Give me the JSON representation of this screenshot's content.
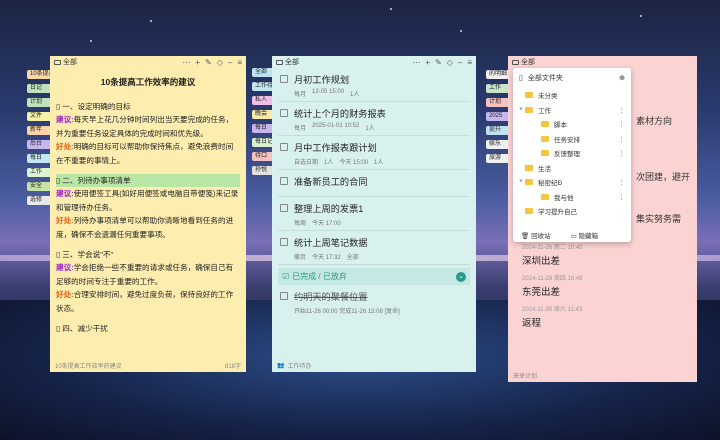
{
  "left_tags": [
    "10条提高",
    "日记",
    "计划",
    "文件",
    "新年",
    "后台",
    "每日",
    "工作",
    "安全",
    "选修"
  ],
  "mid_tags": [
    "全部",
    "工作待",
    "私人",
    "晚会",
    "每日",
    "每日记",
    "待口",
    "孙悦"
  ],
  "right_tags": [
    "的明细",
    "工作",
    "计划",
    "2025",
    "提升",
    "娱乐",
    "旅游"
  ],
  "note1": {
    "window_title": "全部",
    "title": "10条提高工作效率的建议",
    "s1_head": "一、设定明确的目标",
    "s1_kw": "建议:",
    "s1_text": "每天早上花几分钟时间列出当天要完成的任务，并为重要任务设定具体的完成时间和优先级。",
    "s1_kw2": "好处:",
    "s1_text2": "明确的目标可以帮助你保持焦点，避免浪费时间在不重要的事情上。",
    "s2_head": "二、列待办事项清单",
    "s2_kw": "建议:",
    "s2_text": "使用便签工具(如好用便签或电脑自带便笺)来记录和管理待办任务。",
    "s2_kw2": "好处:",
    "s2_text2": "列待办事项清单可以帮助你清晰地看到任务的进度，确保不会遗漏任何重要事项。",
    "s3_head": "三、学会说\"不\"",
    "s3_kw": "建议:",
    "s3_text": "学会拒绝一些不重要的请求或任务，确保自己有足够的时间专注于重要的工作。",
    "s3_kw2": "好处:",
    "s3_text2": "合理安排时间，避免过度负荷，保持良好的工作状态。",
    "s4_head": "四、减少干扰",
    "footer_name": "10条提高工作效率的建议",
    "footer_count": "818字"
  },
  "note2": {
    "window_title": "全部",
    "tasks": [
      {
        "title": "月初工作规划",
        "meta": [
          "每月",
          "12-05 15:00",
          "1人"
        ]
      },
      {
        "title": "统计上个月的财务报表",
        "meta": [
          "每月",
          "2025-01-01 10:52",
          "1人"
        ]
      },
      {
        "title": "月中工作报表跟计划",
        "meta": [
          "自选日期",
          "1人",
          "今天 15:00",
          "1人"
        ]
      },
      {
        "title": "准备新员工的合同",
        "meta": []
      },
      {
        "title": "整理上周的发票1",
        "meta": [
          "每周",
          "今天 17:00"
        ]
      },
      {
        "title": "统计上周笔记数据",
        "meta": [
          "撤页",
          "今天 17:32",
          "全部"
        ]
      }
    ],
    "done_header": "已完成 / 已放弃",
    "done_task": "约明天的聚餐位置",
    "done_meta": "开始11-26 00:00  完成11-26 15:08  [复命]",
    "footer": "工作待办"
  },
  "note3": {
    "window_title": "全部",
    "bg_lines": [
      "素材方向",
      "次团建，避开",
      "集实努务需"
    ],
    "entries": [
      {
        "date": "2024-11-26 周二 10:40",
        "title": "深圳出差"
      },
      {
        "date": "2024-11-28 周四 16:48",
        "title": "东莞出差"
      },
      {
        "date": "2024-11-30 周六 11:43",
        "title": "返程"
      }
    ],
    "footer": "来来计划"
  },
  "menu": {
    "header": "全部文件夹",
    "items": [
      {
        "label": "未分类",
        "level": 0,
        "arrow": ""
      },
      {
        "label": "工作",
        "level": 0,
        "arrow": "v"
      },
      {
        "label": "脚本",
        "level": 1,
        "arrow": ""
      },
      {
        "label": "任务安排",
        "level": 1,
        "arrow": ""
      },
      {
        "label": "反馈整理",
        "level": 1,
        "arrow": ""
      },
      {
        "label": "生活",
        "level": 0,
        "arrow": ""
      },
      {
        "label": "秘密纪Ð",
        "level": 0,
        "arrow": "v"
      },
      {
        "label": "我与他",
        "level": 1,
        "arrow": ""
      },
      {
        "label": "学习提升自己",
        "level": 0,
        "arrow": ""
      }
    ],
    "trash": "回收站",
    "hidden": "隐藏箱"
  }
}
